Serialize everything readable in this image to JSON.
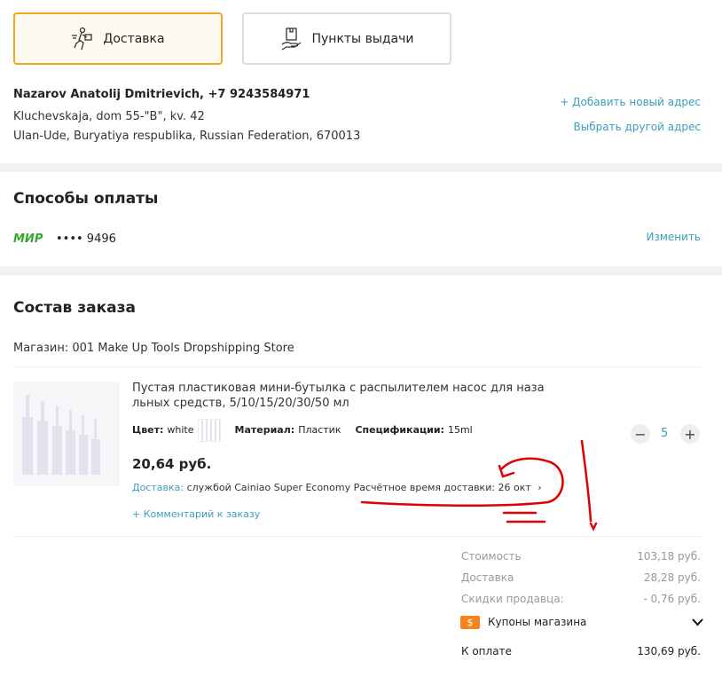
{
  "tabs": [
    {
      "label": "Доставка",
      "icon": "courier-icon",
      "active": true
    },
    {
      "label": "Пункты выдачи",
      "icon": "pickup-box-icon",
      "active": false
    }
  ],
  "address": {
    "name_phone": "Nazarov Anatolij Dmitrievich, +7 9243584971",
    "line1": "Kluchevskaja, dom 55-\"B\", kv. 42",
    "line2": "Ulan-Ude, Buryatiya respublika, Russian Federation, 670013",
    "add_link": "+ Добавить новый адрес",
    "choose_link": "Выбрать другой адрес"
  },
  "payment": {
    "title": "Способы оплаты",
    "card_brand": "МИР",
    "card_mask": "•••• 9496",
    "change_link": "Изменить"
  },
  "order": {
    "title": "Состав заказа",
    "store": "Магазин: 001 Make Up Tools Dropshipping Store",
    "item": {
      "title_line1": "Пустая пластиковая мини-бутылка с распылителем насос для наза",
      "title_line2": "льных средств, 5/10/15/20/30/50 мл",
      "color_label": "Цвет:",
      "color_value": "white",
      "material_label": "Материал:",
      "material_value": "Пластик",
      "spec_label": "Спецификации:",
      "spec_value": "15ml",
      "price": "20,64 руб.",
      "quantity": "5",
      "delivery_label": "Доставка:",
      "delivery_service": "службой Cainiao Super Economy",
      "delivery_eta": "Расчётное время доставки: 26 окт",
      "comment_link": "+ Комментарий к заказу"
    }
  },
  "summary": {
    "cost_label": "Стоимость",
    "cost_value": "103,18 руб.",
    "shipping_label": "Доставка",
    "shipping_value": "28,28 руб.",
    "discount_label": "Скидки продавца:",
    "discount_value": "- 0,76 руб.",
    "coupons_label": "Купоны магазина",
    "total_label": "К оплате",
    "total_value": "130,69 руб."
  },
  "colors": {
    "accent": "#f5a623",
    "link": "#3b9ec0",
    "mir_green": "#37a72e",
    "annotation": "#e00000"
  }
}
